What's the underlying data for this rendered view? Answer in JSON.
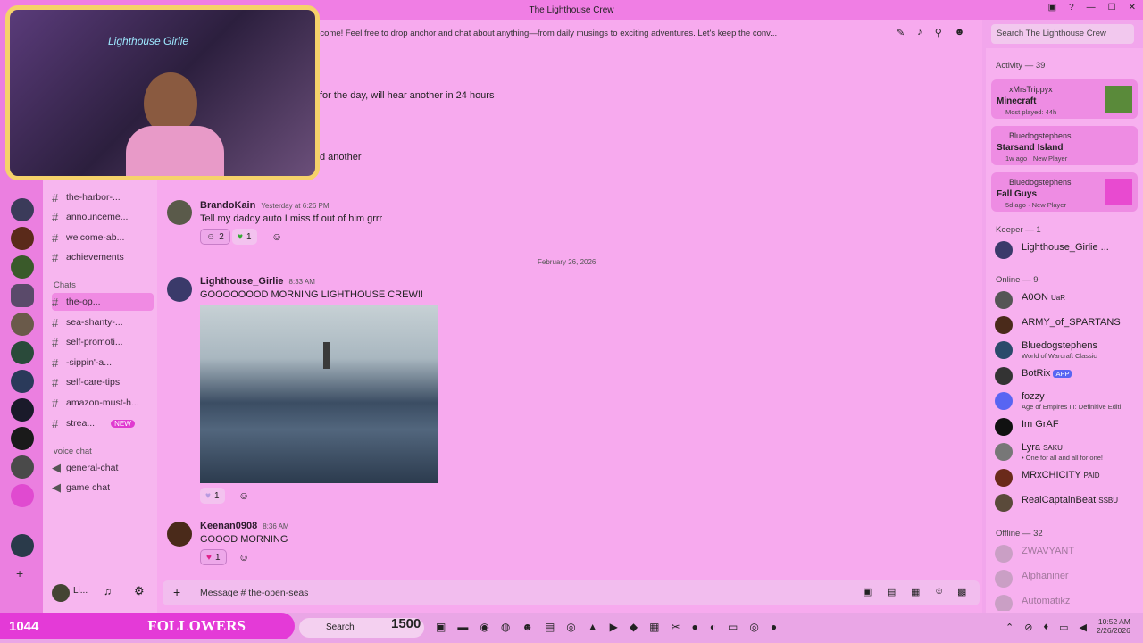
{
  "window": {
    "title": "The Lighthouse Crew"
  },
  "topic": "...neral chat room where all hands are welcome! Feel free to drop anchor and chat about anything—from daily musings to exciting adventures. Let's keep the conv...",
  "search": {
    "placeholder": "Search The Lighthouse Crew"
  },
  "channels": {
    "items_top": [
      {
        "label": "the-harbor-..."
      },
      {
        "label": "announceme..."
      },
      {
        "label": "welcome-ab..."
      },
      {
        "label": "achievements"
      }
    ],
    "chats_category": "Chats",
    "chats": [
      {
        "label": "the-op..."
      },
      {
        "label": "sea-shanty-..."
      },
      {
        "label": "self-promoti..."
      },
      {
        "label": "-sippin'-a..."
      },
      {
        "label": "self-care-tips"
      },
      {
        "label": "amazon-must-h..."
      },
      {
        "label": "strea...",
        "badge": "NEW"
      }
    ],
    "voice_category": "voice chat",
    "voice": [
      {
        "label": "general-chat"
      },
      {
        "label": "game chat"
      }
    ]
  },
  "messages": {
    "partial1": "for the day, will hear another in 24 hours",
    "partial2": "d another",
    "m1": {
      "author": "BrandoKain",
      "time": "Yesterday at 6:26 PM",
      "text": "Tell my daddy auto I miss tf out of  him grrr",
      "react1": "2",
      "react2": "1"
    },
    "divider": "February 26, 2026",
    "m2": {
      "author": "Lighthouse_Girlie",
      "time": "8:33 AM",
      "text": "GOOOOOOOD MORNING LIGHTHOUSE CREW!!",
      "react1": "1"
    },
    "m3": {
      "author": "Keenan0908",
      "time": "8:36 AM",
      "text": "GOOOD MORNING",
      "react1": "1"
    }
  },
  "input": {
    "placeholder": "Message # the-open-seas"
  },
  "user_panel": {
    "name": "Li..."
  },
  "members": {
    "activity_header": "Activity — 39",
    "activities": [
      {
        "user": "xMrsTrippyx",
        "game": "Minecraft",
        "sub": "Most played: 44h"
      },
      {
        "user": "Bluedogstephens",
        "game": "Starsand Island",
        "sub": "1w ago",
        "sub2": "New Player"
      },
      {
        "user": "Bluedogstephens",
        "game": "Fall Guys",
        "sub": "5d ago",
        "sub2": "New Player"
      }
    ],
    "keeper_header": "Keeper — 1",
    "keeper": [
      {
        "name": "Lighthouse_Girlie ..."
      }
    ],
    "online_header": "Online — 9",
    "online": [
      {
        "name": "A0ON",
        "tag": "UaR"
      },
      {
        "name": "ARMY_of_SPARTANS"
      },
      {
        "name": "Bluedogstephens",
        "sub": "World of Warcraft Classic"
      },
      {
        "name": "BotRix",
        "tag": "APP"
      },
      {
        "name": "fozzy",
        "sub": "Age of Empires III: Definitive Editi"
      },
      {
        "name": "Im GrAF"
      },
      {
        "name": "Lyra",
        "tag": "SAKU",
        "sub": "• One for all and all for one!"
      },
      {
        "name": "MRxCHICITY",
        "tag": "PAID"
      },
      {
        "name": "RealCaptainBeat",
        "tag": "SSBU"
      }
    ],
    "offline_header": "Offline — 32",
    "offline": [
      {
        "name": "ZWAVYANT"
      },
      {
        "name": "Alphaniner"
      },
      {
        "name": "Automatikz"
      }
    ]
  },
  "overlay": {
    "followers_count": "1044",
    "followers_label": "FOLLOWERS",
    "goal": "1500",
    "cam_text": "Lighthouse Girlie"
  },
  "taskbar": {
    "search": "Search",
    "time": "10:52 AM",
    "date": "2/26/2026"
  }
}
